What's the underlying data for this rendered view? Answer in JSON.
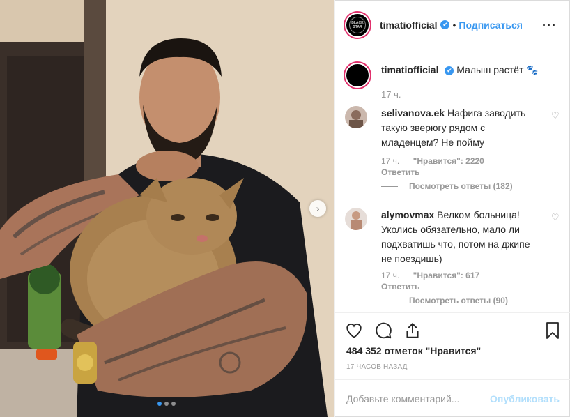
{
  "post": {
    "username": "timatiofficial",
    "separator": "•",
    "follow_label": "Подписаться",
    "more_label": "···",
    "verified_glyph": "✔",
    "avatar_text": "BLACK STAR",
    "caption_text": "Малыш растёт",
    "caption_emoji": "🐾",
    "caption_time": "17 ч.",
    "next_glyph": "›",
    "carousel_total": 3,
    "carousel_active": 1
  },
  "comments": [
    {
      "username": "selivanova.ek",
      "text": "Нафига заводить такую зверюгу рядом с младенцем? Не пойму",
      "time": "17 ч.",
      "likes": "\"Нравится\": 2220",
      "reply_label": "Ответить",
      "view_replies": "Посмотреть ответы (182)"
    },
    {
      "username": "alymovmax",
      "text": "Велком больница! Уколись обязательно, мало ли подхватишь что, потом на джипе не поездишь)",
      "time": "17 ч.",
      "likes": "\"Нравится\": 617",
      "reply_label": "Ответить",
      "view_replies": "Посмотреть ответы (90)"
    }
  ],
  "actions": {
    "likes_text": "484 352 отметок \"Нравится\"",
    "time_ago": "17 ЧАСОВ НАЗАД"
  },
  "add_comment": {
    "placeholder": "Добавьте комментарий...",
    "publish_label": "Опубликовать"
  },
  "icons": {
    "heart": "heart-icon",
    "comment": "comment-icon",
    "share": "share-icon",
    "bookmark": "bookmark-icon",
    "like_small": "small-heart-icon"
  },
  "colors": {
    "accent": "#3897f0",
    "publish_disabled": "#b2dffc",
    "muted": "#999999",
    "text": "#262626"
  }
}
